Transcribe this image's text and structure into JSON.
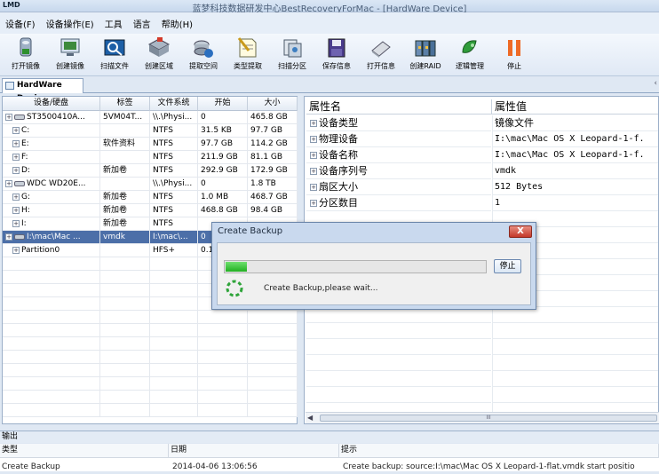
{
  "titlebar": {
    "logo": "LMD",
    "title": "蓝梦科技数据研发中心BestRecoveryForMac - [HardWare Device]"
  },
  "menu": [
    "设备(F)",
    "设备操作(E)",
    "工具",
    "语言",
    "帮助(H)"
  ],
  "toolbar": [
    {
      "label": "打开镜像",
      "icon": "open-image-icon"
    },
    {
      "label": "创建镜像",
      "icon": "create-image-icon"
    },
    {
      "label": "扫描文件",
      "icon": "scan-file-icon"
    },
    {
      "label": "创建区域",
      "icon": "create-area-icon"
    },
    {
      "label": "提取空间",
      "icon": "extract-space-icon"
    },
    {
      "label": "类型提取",
      "icon": "type-extract-icon"
    },
    {
      "label": "扫描分区",
      "icon": "scan-partition-icon"
    },
    {
      "label": "保存信息",
      "icon": "save-info-icon"
    },
    {
      "label": "打开信息",
      "icon": "open-info-icon"
    },
    {
      "label": "创建RAID",
      "icon": "create-raid-icon"
    },
    {
      "label": "逻辑管理",
      "icon": "logic-manage-icon"
    },
    {
      "label": "停止",
      "icon": "stop-icon"
    }
  ],
  "doc_tab": "HardWare Device",
  "device_table": {
    "columns": [
      "设备/硬盘",
      "标签",
      "文件系统",
      "开始",
      "大小"
    ],
    "rows": [
      {
        "name": "ST3500410A...",
        "label": "5VM04T...",
        "fs": "\\\\.\\Physi...",
        "start": "0",
        "size": "465.8 GB",
        "level": 0,
        "type": "disk",
        "selected": false
      },
      {
        "name": "C:",
        "label": "",
        "fs": "NTFS",
        "start": "31.5 KB",
        "size": "97.7 GB",
        "level": 1,
        "type": "part",
        "selected": false
      },
      {
        "name": "E:",
        "label": "软件资料",
        "fs": "NTFS",
        "start": "97.7 GB",
        "size": "114.2 GB",
        "level": 1,
        "type": "part",
        "selected": false
      },
      {
        "name": "F:",
        "label": "",
        "fs": "NTFS",
        "start": "211.9 GB",
        "size": "81.1 GB",
        "level": 1,
        "type": "part",
        "selected": false
      },
      {
        "name": "D:",
        "label": "新加卷",
        "fs": "NTFS",
        "start": "292.9 GB",
        "size": "172.9 GB",
        "level": 1,
        "type": "part",
        "selected": false
      },
      {
        "name": "WDC WD20E...",
        "label": "",
        "fs": "\\\\.\\Physi...",
        "start": "0",
        "size": "1.8 TB",
        "level": 0,
        "type": "disk",
        "selected": false
      },
      {
        "name": "G:",
        "label": "新加卷",
        "fs": "NTFS",
        "start": "1.0 MB",
        "size": "468.7 GB",
        "level": 1,
        "type": "part",
        "selected": false
      },
      {
        "name": "H:",
        "label": "新加卷",
        "fs": "NTFS",
        "start": "468.8 GB",
        "size": "98.4 GB",
        "level": 1,
        "type": "part",
        "selected": false
      },
      {
        "name": "I:",
        "label": "新加卷",
        "fs": "NTFS",
        "start": "",
        "size": "",
        "level": 1,
        "type": "part",
        "selected": false
      },
      {
        "name": "I:\\mac\\Mac ...",
        "label": "vmdk",
        "fs": "I:\\mac\\...",
        "start": "0",
        "size": "",
        "level": 0,
        "type": "disk",
        "selected": true
      },
      {
        "name": "Partition0",
        "label": "",
        "fs": "HFS+",
        "start": "0.1",
        "size": "",
        "level": 1,
        "type": "part",
        "selected": false
      }
    ]
  },
  "properties": {
    "columns": [
      "属性名",
      "属性值"
    ],
    "rows": [
      {
        "name": "设备类型",
        "value": "镜像文件"
      },
      {
        "name": "物理设备",
        "value": "I:\\mac\\Mac OS X Leopard-1-f."
      },
      {
        "name": "设备名称",
        "value": "I:\\mac\\Mac OS X Leopard-1-f."
      },
      {
        "name": "设备序列号",
        "value": "vmdk"
      },
      {
        "name": "扇区大小",
        "value": "512 Bytes"
      },
      {
        "name": "分区数目",
        "value": "1"
      }
    ]
  },
  "scrollbar": {
    "thumb_text": "III"
  },
  "dialog": {
    "title": "Create Backup",
    "close": "X",
    "progress": 0.08,
    "stop_label": "停止",
    "message": "Create Backup,please wait..."
  },
  "output": {
    "title": "输出",
    "columns": [
      "类型",
      "日期",
      "提示"
    ],
    "row": {
      "type": "Create Backup",
      "date": "2014-04-06 13:06:56",
      "hint": "Create backup: source:I:\\mac\\Mac OS X Leopard-1-flat.vmdk start positio"
    }
  }
}
